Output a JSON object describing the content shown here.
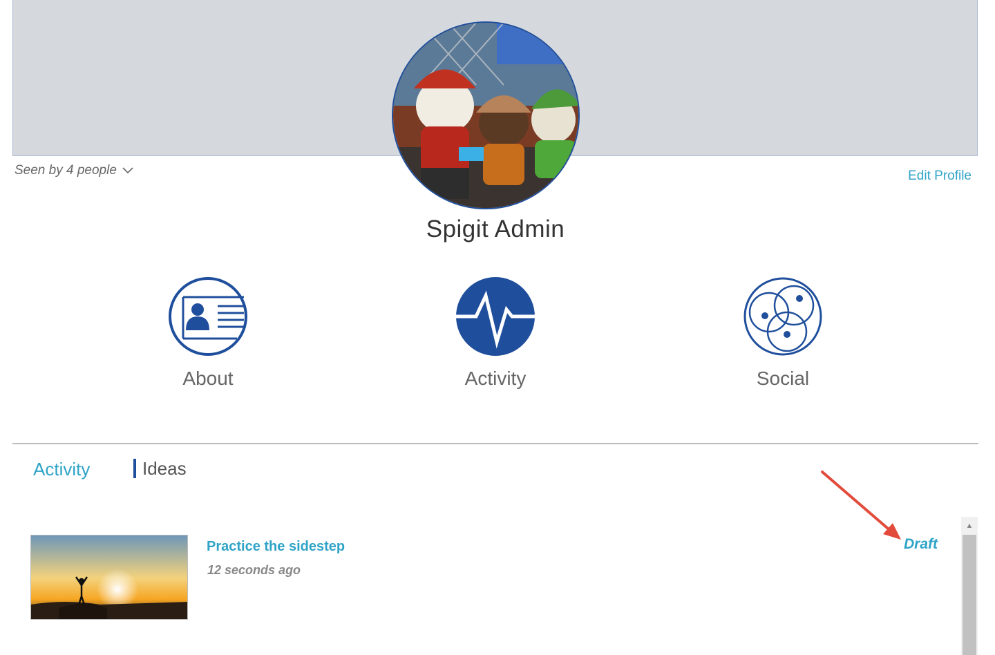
{
  "profile": {
    "seen_by": "Seen by 4 people",
    "edit_profile": "Edit Profile",
    "name": "Spigit Admin"
  },
  "nav": [
    {
      "label": "About",
      "icon": "id-card-icon"
    },
    {
      "label": "Activity",
      "icon": "pulse-icon"
    },
    {
      "label": "Social",
      "icon": "network-circles-icon"
    }
  ],
  "tabs": {
    "activity": "Activity",
    "ideas": "Ideas"
  },
  "ideas": [
    {
      "title": "Practice the sidestep",
      "time": "12 seconds ago",
      "status": "Draft"
    }
  ],
  "colors": {
    "accent": "#2ea3c7",
    "brand_blue": "#1f4f9c",
    "cover": "#d5d9de",
    "annotation_arrow": "#e24b3b"
  }
}
